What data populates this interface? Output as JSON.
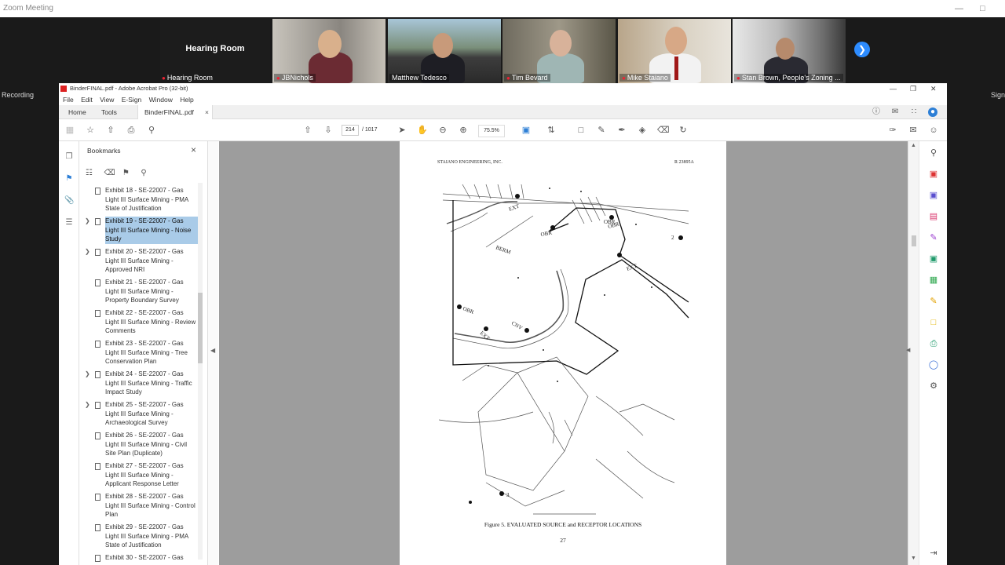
{
  "zoom": {
    "window_title": "Zoom Meeting",
    "hearing_room_label": "Hearing Room",
    "recording_label": "Recording",
    "sign_label": "Sign",
    "participants": [
      {
        "name": "Hearing Room"
      },
      {
        "name": "JBNichols"
      },
      {
        "name": "Matthew Tedesco"
      },
      {
        "name": "Tim Bevard"
      },
      {
        "name": "Mike Staiano"
      },
      {
        "name": "Stan Brown, People's Zoning ..."
      }
    ]
  },
  "acrobat": {
    "title": "BinderFINAL.pdf - Adobe Acrobat Pro (32-bit)",
    "menu": [
      "File",
      "Edit",
      "View",
      "E-Sign",
      "Window",
      "Help"
    ],
    "tabs": {
      "home": "Home",
      "tools": "Tools",
      "document": "BinderFINAL.pdf"
    },
    "page_current": "214",
    "page_total": "/ 1017",
    "zoom": "75.5%",
    "bookmarks_title": "Bookmarks",
    "bookmarks": [
      {
        "text": "Exhibit 18 - SE-22007 - Gas Light III Surface Mining - PMA State of Justification",
        "expandable": false,
        "selected": false
      },
      {
        "text": "Exhibit 19 - SE-22007 - Gas Light III Surface Mining - Noise Study",
        "expandable": true,
        "selected": true
      },
      {
        "text": "Exhibit 20 - SE-22007 - Gas Light III Surface Mining - Approved NRI",
        "expandable": true,
        "selected": false
      },
      {
        "text": "Exhibit 21 - SE-22007 - Gas Light III Surface Mining - Property Boundary Survey",
        "expandable": false,
        "selected": false
      },
      {
        "text": "Exhibit 22 - SE-22007 - Gas Light III Surface Mining - Review Comments",
        "expandable": false,
        "selected": false
      },
      {
        "text": "Exhibit 23 - SE-22007 - Gas Light III Surface Mining - Tree Conservation Plan",
        "expandable": false,
        "selected": false
      },
      {
        "text": "Exhibit 24 - SE-22007 - Gas Light III Surface Mining - Traffic Impact Study",
        "expandable": true,
        "selected": false
      },
      {
        "text": "Exhibit 25 - SE-22007 - Gas Light III Surface Mining - Archaeological Survey",
        "expandable": true,
        "selected": false
      },
      {
        "text": "Exhibit 26 - SE-22007 - Gas Light III Surface Mining - Civil Site Plan (Duplicate)",
        "expandable": false,
        "selected": false
      },
      {
        "text": "Exhibit 27 - SE-22007 - Gas Light III Surface Mining - Applicant Response Letter",
        "expandable": false,
        "selected": false
      },
      {
        "text": "Exhibit 28 - SE-22007 - Gas Light III Surface Mining - Control Plan",
        "expandable": false,
        "selected": false
      },
      {
        "text": "Exhibit 29 - SE-22007 - Gas Light III Surface Mining - PMA State of Justification",
        "expandable": false,
        "selected": false
      },
      {
        "text": "Exhibit 30 - SE-22007 - Gas",
        "expandable": false,
        "selected": false
      }
    ]
  },
  "document": {
    "header_left": "STAIANO ENGINEERING, INC.",
    "header_right": "R 23895A",
    "figure_caption": "Figure 5.  EVALUATED SOURCE and RECEPTOR LOCATIONS",
    "page_number": "27",
    "map_labels": [
      "EXT",
      "OBR",
      "BERM",
      "OBR",
      "OBR",
      "EXT",
      "CNV",
      "EXT",
      "OBR",
      "2",
      "3"
    ]
  }
}
